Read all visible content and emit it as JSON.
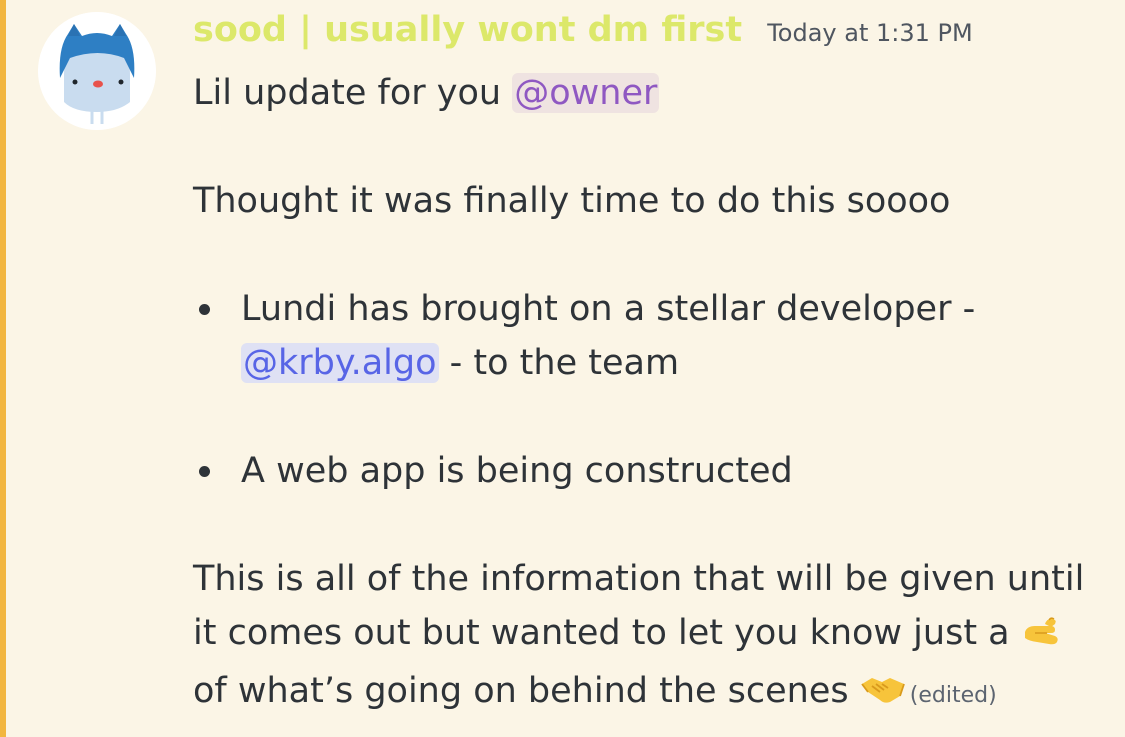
{
  "message": {
    "author": {
      "username": "sood | usually wont dm first",
      "username_color": "#dce86a",
      "timestamp": "Today at 1:31 PM",
      "avatar": "blue-hooded-ghost-avatar"
    },
    "line1_text": "Lil update for you ",
    "mention_role": "@owner",
    "line2_text": "Thought it was finally time to do this soooo",
    "bullets": [
      {
        "before": "Lundi has brought on a stellar developer - ",
        "mention": "@krby.algo",
        "after": " - to the team"
      },
      {
        "text": "A web app is being constructed"
      }
    ],
    "closing_text_1": "This is all of the information that will be given until it comes out but wanted to let you know just a ",
    "emoji_pinch": "pinching-hand-emoji",
    "closing_text_2": " of what’s going on behind the scenes ",
    "emoji_handshake": "handshake-emoji",
    "edited_label": "(edited)"
  },
  "colors": {
    "background": "#fbf5e6",
    "accent_bar": "#f2b640",
    "role_mention": "#8f58c2",
    "user_mention": "#5865e6"
  }
}
